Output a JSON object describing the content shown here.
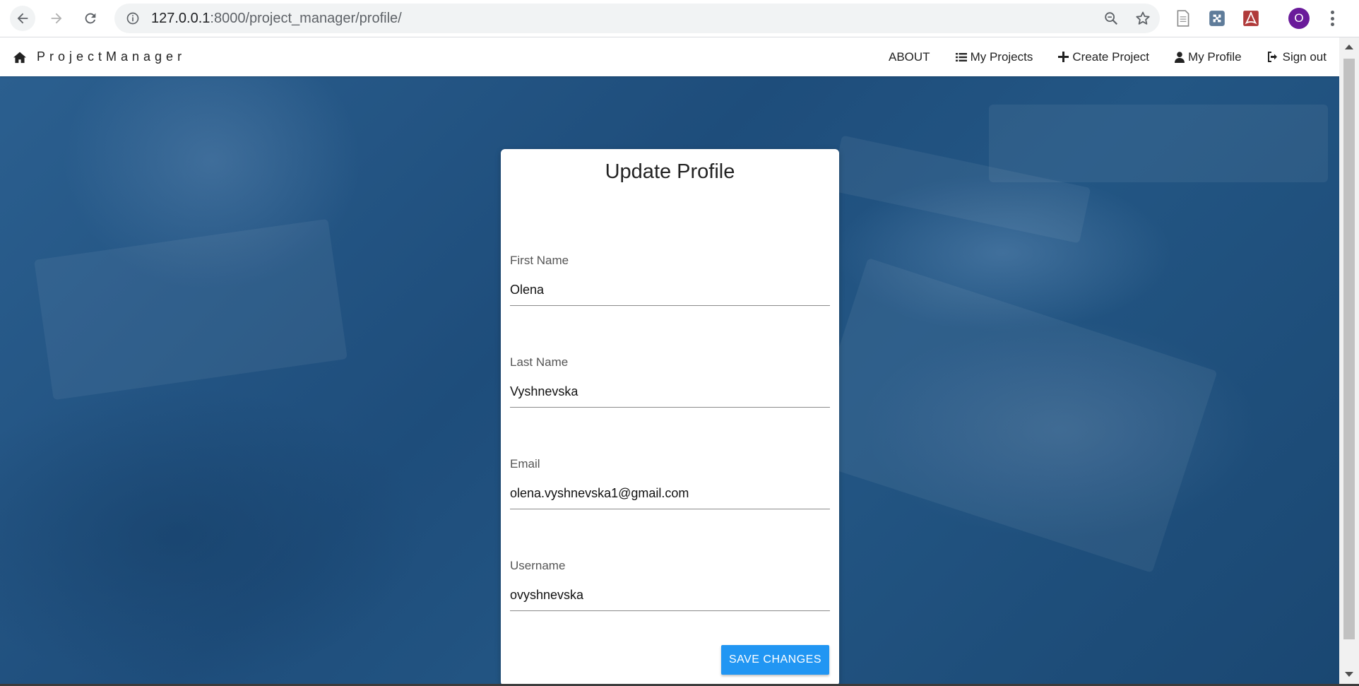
{
  "browser": {
    "url_host": "127.0.0.1",
    "url_path": ":8000/project_manager/profile/",
    "avatar_letter": "O",
    "icons": [
      "back-icon",
      "forward-icon",
      "reload-icon",
      "info-icon",
      "zoom-icon",
      "star-icon",
      "document-extension-icon",
      "puzzle-extension-icon",
      "pdf-extension-icon",
      "menu-icon"
    ]
  },
  "nav": {
    "brand": "ProjectManager",
    "about": "ABOUT",
    "my_projects": "My Projects",
    "create_project": "Create Project",
    "my_profile": "My Profile",
    "sign_out": "Sign out"
  },
  "form": {
    "title": "Update Profile",
    "first_name_label": "First Name",
    "first_name_value": "Olena",
    "last_name_label": "Last Name",
    "last_name_value": "Vyshnevska",
    "email_label": "Email",
    "email_value": "olena.vyshnevska1@gmail.com",
    "username_label": "Username",
    "username_value": "ovyshnevska",
    "save_label": "SAVE CHANGES"
  },
  "colors": {
    "primary_button": "#2196f3",
    "hero_overlay": "#1e4d7b",
    "avatar": "#6a1b9a"
  }
}
